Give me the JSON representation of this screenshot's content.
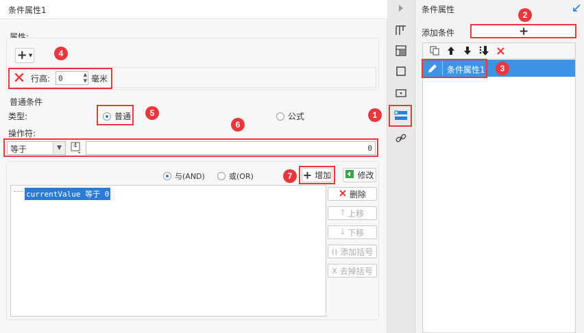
{
  "dialog": {
    "title": "条件属性1",
    "property_group": {
      "legend": "属性:",
      "row_height_label": "行高:",
      "row_height_value": "0",
      "row_height_unit": "毫米"
    },
    "normal_condition": {
      "legend": "普通条件",
      "type_label": "类型:",
      "type_normal": "普通",
      "type_formula": "公式",
      "selected_type": "普通",
      "operator_label": "操作符:",
      "operator_value": "等于",
      "value_field": "0",
      "value_type_icon": "4"
    },
    "logic": {
      "and_label": "与(AND)",
      "or_label": "或(OR)",
      "selected": "AND"
    },
    "buttons": {
      "add": "增加",
      "modify": "修改",
      "delete": "删除",
      "move_up": "上移",
      "move_down": "下移",
      "add_bracket": "添加括号",
      "remove_bracket": "去掉括号"
    },
    "condition_list": [
      "currentValue 等于 0"
    ]
  },
  "right_panel": {
    "title": "条件属性",
    "add_condition_label": "添加条件",
    "items": [
      "条件属性1"
    ]
  },
  "badges": [
    "1",
    "2",
    "3",
    "4",
    "5",
    "6",
    "7"
  ],
  "colors": {
    "accent_red": "#e8383d",
    "selection_blue": "#3d93e8",
    "highlight_blue": "#2b7bd6"
  }
}
